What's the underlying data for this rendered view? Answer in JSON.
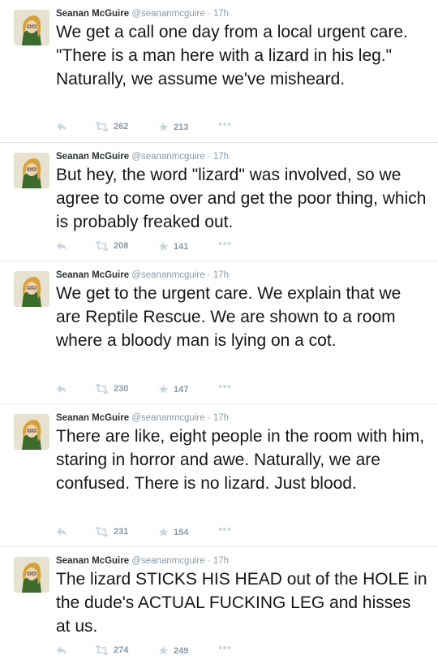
{
  "user": {
    "name": "Seanan McGuire",
    "handle": "@seananmcguire",
    "time": "17h",
    "separator": "·"
  },
  "icons": {
    "reply": "reply-icon",
    "retweet": "retweet-icon",
    "favorite": "star-icon",
    "more": "more-icon"
  },
  "tweets": [
    {
      "text": "We get a call one day from a local urgent care. \"There is a man here with a lizard in his leg.\" Naturally, we assume we've misheard.",
      "retweets": "262",
      "favorites": "213"
    },
    {
      "text": "But hey, the word \"lizard\" was involved, so we agree to come over and get the poor thing, which is probably freaked out.",
      "retweets": "208",
      "favorites": "141"
    },
    {
      "text": "We get to the urgent care. We explain that we are Reptile Rescue. We are shown to a room where a bloody man is lying on a cot.",
      "retweets": "230",
      "favorites": "147"
    },
    {
      "text": "There are like, eight people in the room with him, staring in horror and awe. Naturally, we are confused. There is no lizard. Just blood.",
      "retweets": "231",
      "favorites": "154"
    },
    {
      "text": "The lizard STICKS HIS HEAD out of the HOLE in the dude's ACTUAL FUCKING LEG and hisses at us.",
      "retweets": "274",
      "favorites": "249"
    }
  ]
}
